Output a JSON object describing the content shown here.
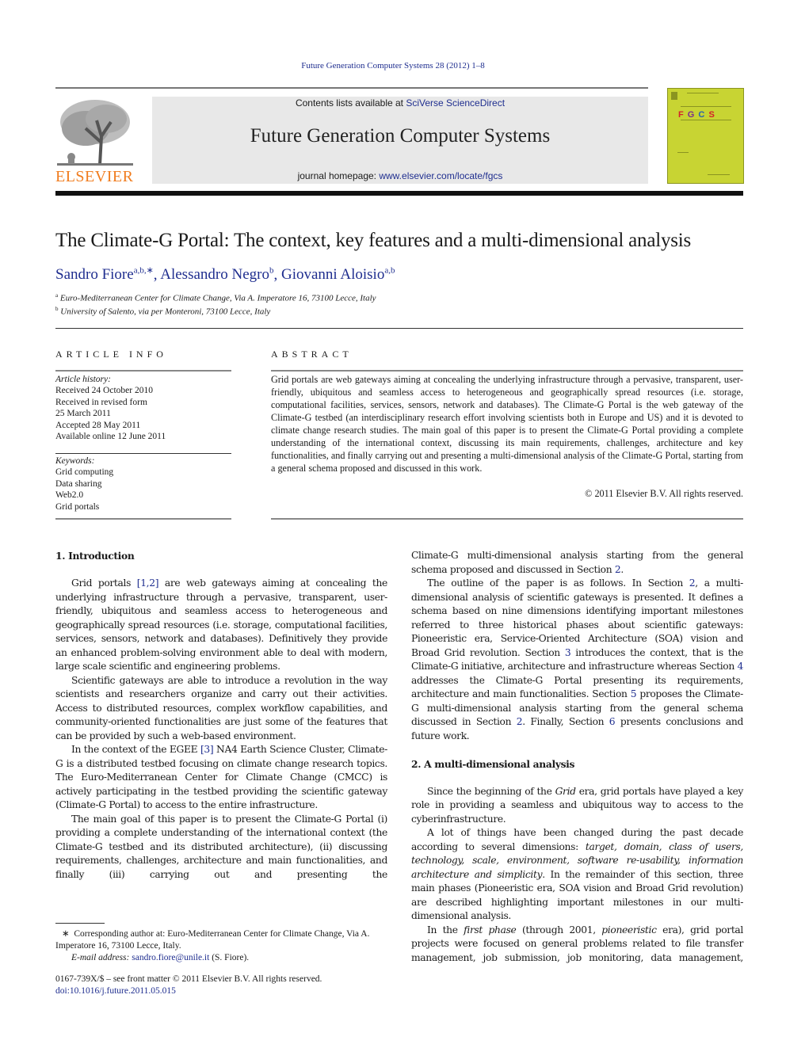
{
  "running_head": "Future Generation Computer Systems 28 (2012) 1–8",
  "masthead": {
    "publisher": "ELSEVIER",
    "contents_prefix": "Contents lists available at ",
    "contents_link": "SciVerse ScienceDirect",
    "journal_title": "Future Generation Computer Systems",
    "homepage_prefix": "journal homepage: ",
    "homepage_link": "www.elsevier.com/locate/fgcs",
    "cover_letters": [
      "F",
      "G",
      "C",
      "S"
    ],
    "cover_letter_colors": [
      "#d3202a",
      "#7b2d8e",
      "#2a62b0",
      "#d3202a"
    ]
  },
  "article": {
    "title": "The Climate-G Portal: The context, key features and a multi-dimensional analysis",
    "authors": [
      {
        "name": "Sandro Fiore",
        "sup": "a,b,∗",
        "sep": ", "
      },
      {
        "name": "Alessandro Negro",
        "sup": "b",
        "sep": ", "
      },
      {
        "name": "Giovanni Aloisio",
        "sup": "a,b",
        "sep": ""
      }
    ],
    "affiliations": [
      {
        "mark": "a",
        "text": "Euro-Mediterranean Center for Climate Change, Via A. Imperatore 16, 73100 Lecce, Italy"
      },
      {
        "mark": "b",
        "text": "University of Salento, via per Monteroni, 73100 Lecce, Italy"
      }
    ]
  },
  "article_info": {
    "heading": "ARTICLE INFO",
    "history_label": "Article history:",
    "history": [
      "Received 24 October 2010",
      "Received in revised form",
      "25 March 2011",
      "Accepted 28 May 2011",
      "Available online 12 June 2011"
    ],
    "keywords_label": "Keywords:",
    "keywords": [
      "Grid computing",
      "Data sharing",
      "Web2.0",
      "Grid portals"
    ]
  },
  "abstract": {
    "heading": "ABSTRACT",
    "text": "Grid portals are web gateways aiming at concealing the underlying infrastructure through a pervasive, transparent, user-friendly, ubiquitous and seamless access to heterogeneous and geographically spread resources (i.e. storage, computational facilities, services, sensors, network and databases). The Climate-G Portal is the web gateway of the Climate-G testbed (an interdisciplinary research effort involving scientists both in Europe and US) and it is devoted to climate change research studies. The main goal of this paper is to present the Climate-G Portal providing a complete understanding of the international context, discussing its main requirements, challenges, architecture and key functionalities, and finally carrying out and presenting a multi-dimensional analysis of the Climate-G Portal, starting from a general schema proposed and discussed in this work.",
    "copyright": "© 2011 Elsevier B.V. All rights reserved."
  },
  "body": {
    "sec1_heading": "1.  Introduction",
    "p1": {
      "a": "Grid portals ",
      "ref": "[1,2]",
      "b": " are web gateways aiming at concealing the underlying infrastructure through a pervasive, transparent, user-friendly, ubiquitous and seamless access to heterogeneous and geographically spread resources (i.e. storage, computational facilities, services, sensors, network and databases). Definitively they provide an enhanced problem-solving environment able to deal with modern, large scale scientific and engineering problems."
    },
    "p2": "Scientific gateways are able to introduce a revolution in the way scientists and researchers organize and carry out their activities. Access to distributed resources, complex workflow capabilities, and community-oriented functionalities are just some of the features that can be provided by such a web-based environment.",
    "p3": {
      "a": "In the context of the EGEE ",
      "ref": "[3]",
      "b": " NA4 Earth Science Cluster, Climate-G is a distributed testbed focusing on climate change research topics. The Euro-Mediterranean Center for Climate Change (CMCC) is actively participating in the testbed providing the scientific gateway (Climate-G Portal) to access to the entire infrastructure."
    },
    "p4": "The main goal of this paper is to present the Climate-G Portal (i) providing a complete understanding of the international context (the Climate-G testbed and its distributed architecture), (ii) discussing requirements, challenges, architecture and main functionalities, and finally (iii) carrying out and presenting the",
    "p4_cont": {
      "a": "Climate-G multi-dimensional analysis starting from the general schema proposed and discussed in Section ",
      "ref": "2",
      "b": "."
    },
    "p5": {
      "s1": "The outline of the paper is as follows. In Section ",
      "r1": "2",
      "s2": ", a multi-dimensional analysis of scientific gateways is presented. It defines a schema based on nine dimensions identifying important milestones referred to three historical phases about scientific gateways: Pioneeristic era, Service-Oriented Architecture (SOA) vision and Broad Grid revolution. Section ",
      "r2": "3",
      "s3": " introduces the context, that is the Climate-G initiative, architecture and infrastructure whereas Section ",
      "r3": "4",
      "s4": " addresses the Climate-G Portal presenting its requirements, architecture and main functionalities. Section ",
      "r4": "5",
      "s5": " proposes the Climate-G multi-dimensional analysis starting from the general schema discussed in Section ",
      "r5": "2",
      "s6": ". Finally, Section ",
      "r6": "6",
      "s7": " presents conclusions and future work."
    },
    "sec2_heading": "2.  A multi-dimensional analysis",
    "p6": {
      "a": "Since the beginning of the ",
      "em": "Grid",
      "b": " era, grid portals have played a key role in providing a seamless and ubiquitous way to access to the cyberinfrastructure."
    },
    "p7": {
      "a": "A lot of things have been changed during the past decade according to several dimensions: ",
      "em": "target, domain, class of users, technology, scale, environment, software re-usability, information architecture and simplicity",
      "b": ". In the remainder of this section, three main phases (Pioneeristic era, SOA vision and Broad Grid revolution) are described highlighting important milestones in our multi-dimensional analysis."
    },
    "p8": {
      "a": "In the ",
      "em1": "first phase",
      "b": " (through 2001, ",
      "em2": "pioneeristic",
      "c": " era), grid portal projects were focused on general problems related to file transfer management, job submission, job monitoring, data management,"
    }
  },
  "footnotes": {
    "mark": "∗",
    "corresponding": "Corresponding author at: Euro-Mediterranean Center for Climate Change, Via A. Imperatore 16, 73100 Lecce, Italy.",
    "email_label": "E-mail address: ",
    "email": "sandro.fiore@unile.it",
    "email_suffix": " (S. Fiore).",
    "front_matter": "0167-739X/$ – see front matter © 2011 Elsevier B.V. All rights reserved.",
    "doi": "doi:10.1016/j.future.2011.05.015"
  }
}
